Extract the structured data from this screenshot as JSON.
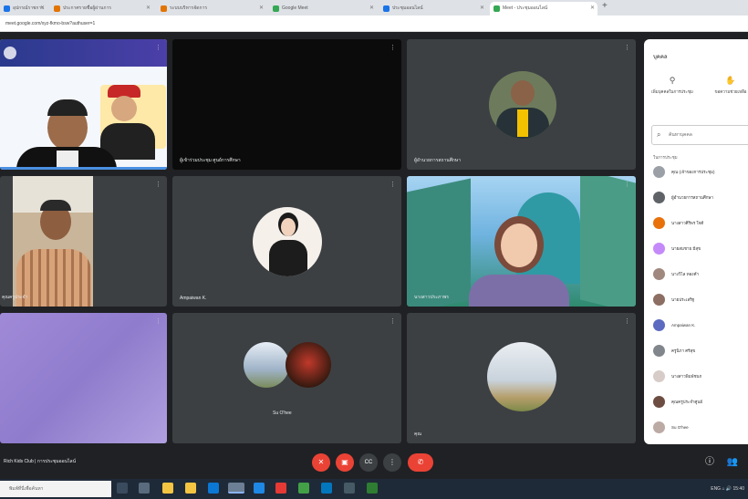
{
  "browser": {
    "tabs": [
      {
        "label": "อุปกรณ์ราชการ",
        "color": "#1a73e8"
      },
      {
        "label": "ประกาศรายชื่อผู้ผ่านการ",
        "color": "#e37400"
      },
      {
        "label": "ระบบบริหารจัดการ",
        "color": "#e37400"
      },
      {
        "label": "Google Meet",
        "color": "#34a853"
      },
      {
        "label": "ประชุมออนไลน์",
        "color": "#1a73e8"
      },
      {
        "label": "Meet - ประชุมออนไลน์",
        "color": "#34a853",
        "active": true
      }
    ],
    "new_tab": "+",
    "address": "meet.google.com/xyz-fkmo-bsw?authuser=1"
  },
  "tiles": [
    {
      "name": "",
      "kind": "slide"
    },
    {
      "name": "ผู้เข้าร่วมประชุม ศูนย์การศึกษา",
      "kind": "black"
    },
    {
      "name": "ผู้อำนวยการสถานศึกษา",
      "kind": "avatar"
    },
    {
      "name": "คุณครูประจำ",
      "kind": "video"
    },
    {
      "name": "Ampaiwan K.",
      "kind": "avatar"
    },
    {
      "name": "นางสาวประภาพร",
      "kind": "scenic"
    },
    {
      "name": "",
      "kind": "purple"
    },
    {
      "name": "Su O'hee",
      "kind": "double"
    },
    {
      "name": "คุณ",
      "kind": "avatar"
    }
  ],
  "panel": {
    "title": "บุคคล",
    "add_people": "เพิ่มบุคคลในการประชุม",
    "ask_help": "ขอความช่วยเหลือ",
    "search_placeholder": "ค้นหาบุคคล",
    "section_label": "ในการประชุม",
    "participants": [
      "คุณ (เจ้าของการประชุม)",
      "ผู้อำนวยการสถานศึกษา",
      "นางสาวศิริพร ใจดี",
      "นายสมชาย มีสุข",
      "นางวิไล ทองคำ",
      "นายประเสริฐ",
      "Ampaiwan K.",
      "ครูนิภา ศรีสุข",
      "นางสาวพิมพ์ชนก",
      "คุณครูประจำศูนย์",
      "Su O'hee"
    ],
    "avatar_colors": [
      "#9aa0a6",
      "#5f6368",
      "#e8710a",
      "#c58af9",
      "#a1887f",
      "#8d6e63",
      "#5c6bc0",
      "#80868b",
      "#d7ccc8",
      "#6d4c41",
      "#bcaaa4"
    ]
  },
  "meeting": {
    "title": "Rich Kids Club | การประชุมออนไลน์"
  },
  "controls": {
    "mic": "mic-off",
    "cam": "cam-off",
    "cc": "CC",
    "present": "present",
    "more": "⋮",
    "end": "✆"
  },
  "taskbar": {
    "search": "พิมพ์ที่นี่เพื่อค้นหา",
    "tray": "ENG ⌂ 🔊 15:40"
  }
}
